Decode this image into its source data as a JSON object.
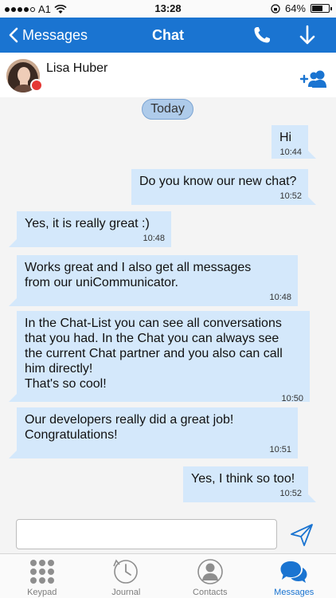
{
  "status_bar": {
    "carrier": "A1",
    "time": "13:28",
    "battery": "64%",
    "battery_level": 0.64
  },
  "nav": {
    "back_label": "Messages",
    "title": "Chat"
  },
  "contact": {
    "name": "Lisa Huber",
    "status_color": "#e53935"
  },
  "chat": {
    "date_label": "Today",
    "messages": [
      {
        "direction": "outgoing",
        "text": "Hi",
        "time": "10:44"
      },
      {
        "direction": "outgoing",
        "text": "Do you know our new chat?",
        "time": "10:52"
      },
      {
        "direction": "incoming",
        "text": "Yes, it is really great :)",
        "time": "10:48"
      },
      {
        "direction": "incoming",
        "text": "Works great and I also get all messages\nfrom our uniCommunicator.",
        "time": "10:48"
      },
      {
        "direction": "incoming",
        "text": "In the Chat-List you can see all conversations\nthat you had. In the Chat you can always see\nthe current Chat partner and you also can call\nhim directly!\nThat's so cool!",
        "time": "10:50"
      },
      {
        "direction": "incoming",
        "text": "Our developers really did a great job!\nCongratulations!",
        "time": "10:51"
      },
      {
        "direction": "outgoing",
        "text": "Yes, I think so too!",
        "time": "10:52"
      }
    ]
  },
  "composer": {
    "value": "",
    "placeholder": ""
  },
  "tabs": [
    {
      "label": "Keypad",
      "active": false
    },
    {
      "label": "Journal",
      "active": false
    },
    {
      "label": "Contacts",
      "active": false
    },
    {
      "label": "Messages",
      "active": true
    }
  ],
  "colors": {
    "accent": "#1a74d1",
    "bubble": "#d4e8fb",
    "date_pill": "#aecbea"
  }
}
